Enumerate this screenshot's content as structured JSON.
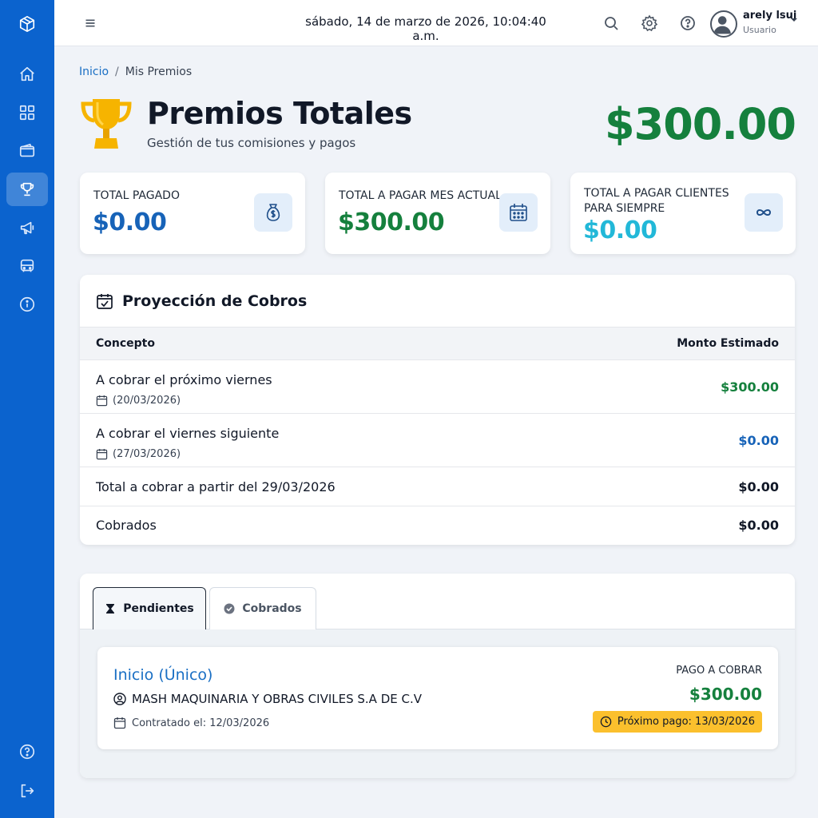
{
  "sidebar": {
    "logo_icon": "cube-icon",
    "items": [
      {
        "icon": "home-icon"
      },
      {
        "icon": "grid-icon"
      },
      {
        "icon": "wallet-icon"
      },
      {
        "icon": "trophy-icon",
        "active": true
      },
      {
        "icon": "megaphone-icon"
      },
      {
        "icon": "bus-icon"
      },
      {
        "icon": "info-icon"
      }
    ],
    "bottom_items": [
      {
        "icon": "help-icon"
      },
      {
        "icon": "logout-icon"
      }
    ],
    "color": "#0b63ce"
  },
  "topbar": {
    "datetime": "sábado, 14 de marzo de 2026, 10:04:40 a.m.",
    "user_name": "arely lsui",
    "user_role": "Usuario"
  },
  "breadcrumb": {
    "home": "Inicio",
    "separator": "/",
    "current": "Mis Premios"
  },
  "header": {
    "title": "Premios Totales",
    "subtitle": "Gestión de tus comisiones y pagos",
    "total": "$300.00"
  },
  "stats": [
    {
      "label": "TOTAL PAGADO",
      "value": "$0.00",
      "color": "#1763b8",
      "icon": "money-bag-icon"
    },
    {
      "label": "TOTAL A PAGAR MES ACTUAL",
      "value": "$300.00",
      "color": "#15803d",
      "icon": "calendar-icon"
    },
    {
      "label": "TOTAL A PAGAR CLIENTES PARA SIEMPRE",
      "value": "$0.00",
      "color": "#22b8d8",
      "icon": "infinity-icon"
    }
  ],
  "projection": {
    "title": "Proyección de Cobros",
    "col_concept": "Concepto",
    "col_amount": "Monto Estimado",
    "rows": [
      {
        "concept": "A cobrar el próximo viernes",
        "date": "(20/03/2026)",
        "amount": "$300.00",
        "color": "#15803d"
      },
      {
        "concept": "A cobrar el viernes siguiente",
        "date": "(27/03/2026)",
        "amount": "$0.00",
        "color": "#1763b8"
      },
      {
        "concept": "Total a cobrar a partir del 29/03/2026",
        "amount": "$0.00",
        "color": "#111827"
      },
      {
        "concept": "Cobrados",
        "amount": "$0.00",
        "color": "#111827"
      }
    ]
  },
  "tabs": [
    {
      "label": "Pendientes",
      "icon": "hourglass-icon",
      "active": true
    },
    {
      "label": "Cobrados",
      "icon": "check-circle-icon",
      "active": false
    }
  ],
  "pending_item": {
    "title": "Inicio (Único)",
    "client": "MASH MAQUINARIA Y OBRAS CIVILES S.A DE C.V",
    "contracted": "Contratado el: 12/03/2026",
    "pay_label": "PAGO A COBRAR",
    "pay_amount": "$300.00",
    "next_payment": "Próximo pago: 13/03/2026"
  }
}
